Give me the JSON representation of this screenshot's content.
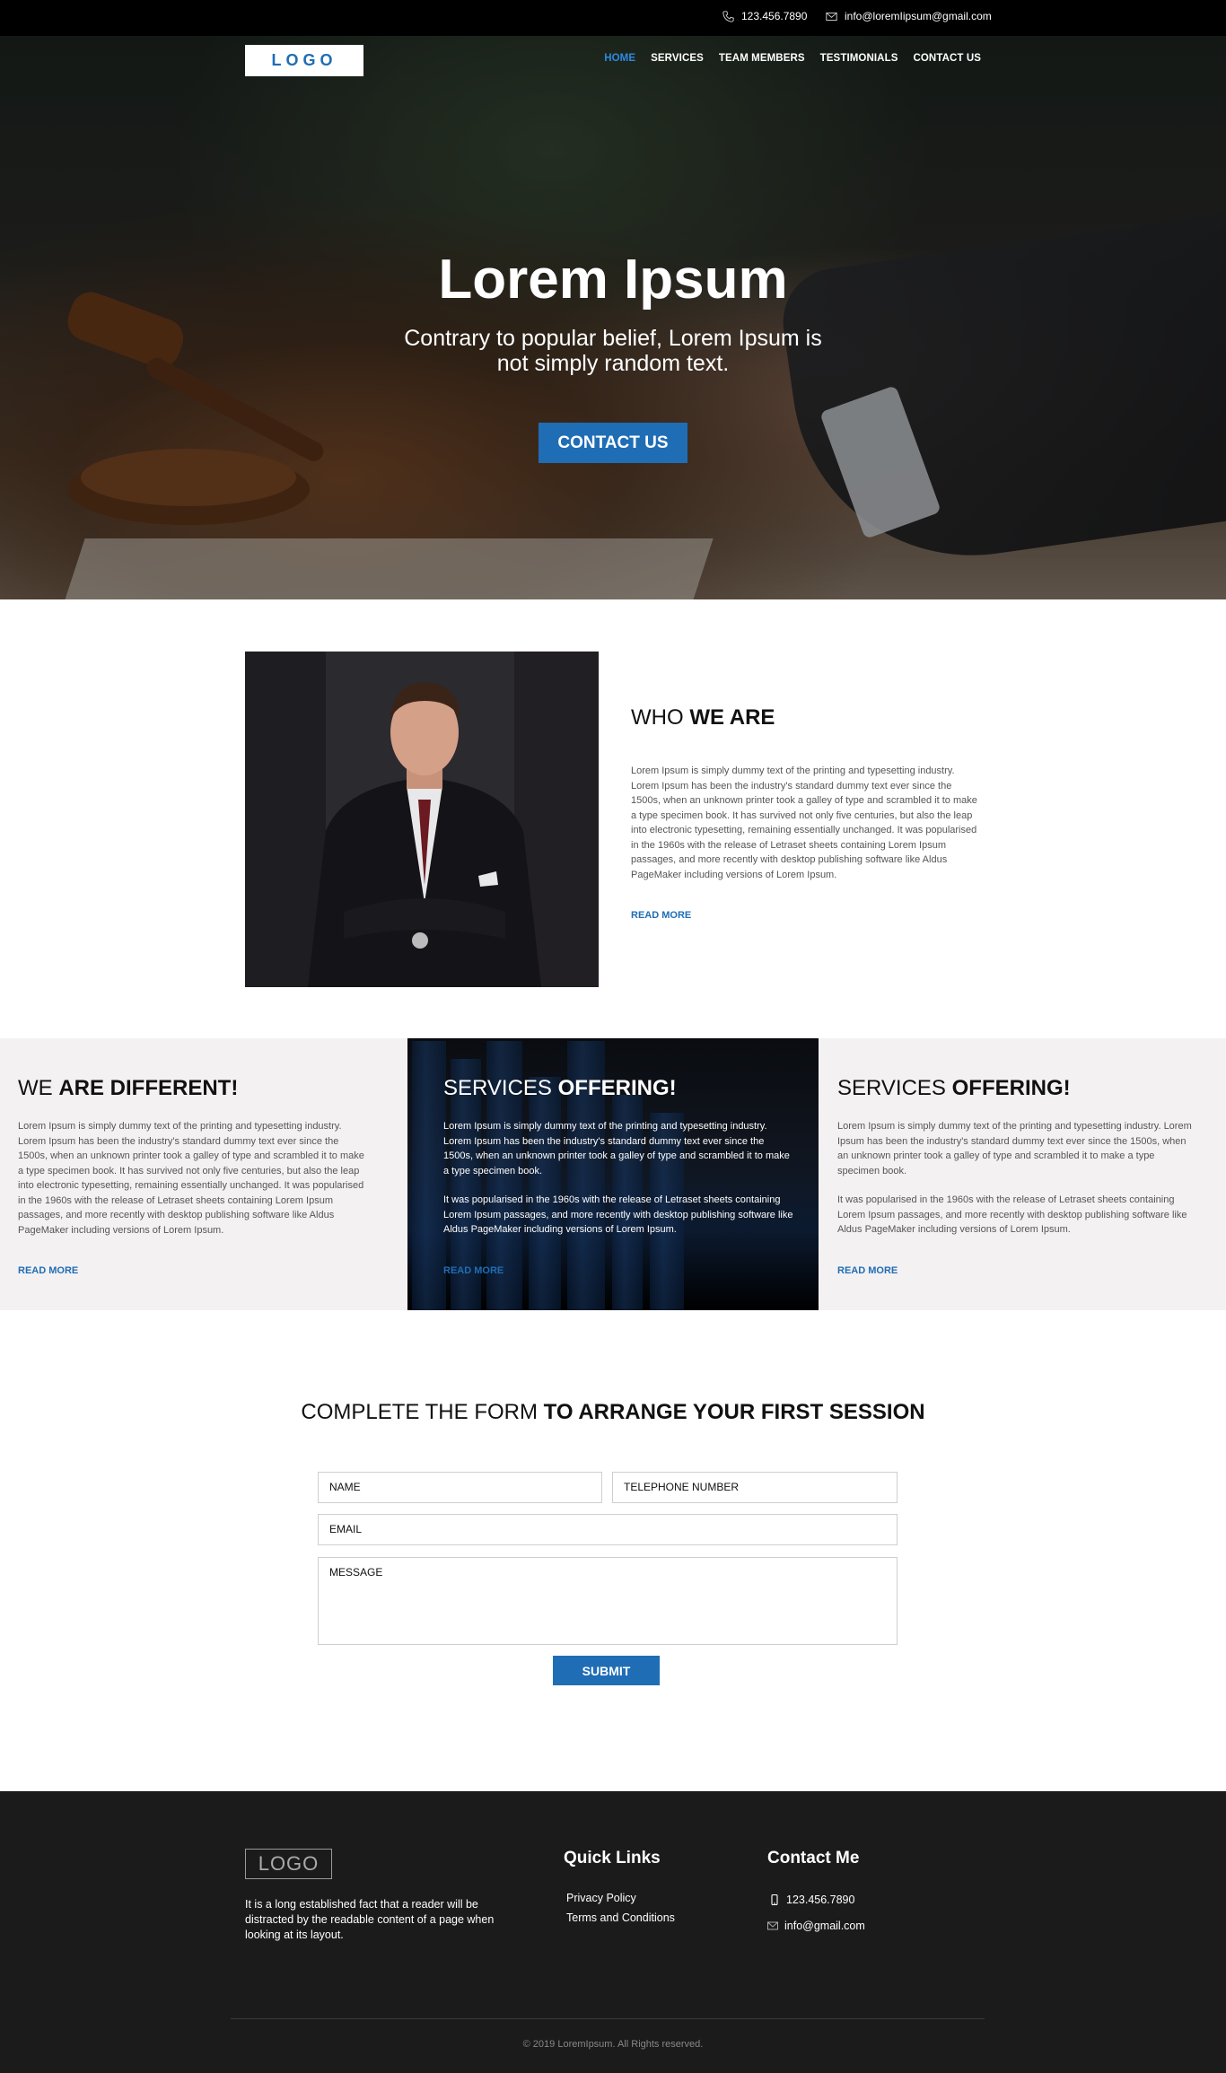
{
  "topbar": {
    "phone": "123.456.7890",
    "email": "info@loremIipsum@gmail.com",
    "phone_icon": "phone-icon",
    "email_icon": "envelope-icon"
  },
  "header": {
    "logo": "LOGO",
    "nav": [
      {
        "label": "HOME",
        "active": true
      },
      {
        "label": "SERVICES",
        "active": false
      },
      {
        "label": "TEAM MEMBERS",
        "active": false
      },
      {
        "label": "TESTIMONIALS",
        "active": false
      },
      {
        "label": "CONTACT US",
        "active": false
      }
    ],
    "active_color": "#2b8ae0"
  },
  "hero": {
    "title": "Lorem Ipsum",
    "subtitle": "Contrary to popular belief, Lorem Ipsum is not simply random text.",
    "cta": "CONTACT US"
  },
  "who": {
    "title_light": "WHO ",
    "title_bold": "WE ARE",
    "text": "Lorem Ipsum is simply dummy text of the printing and typesetting industry. Lorem Ipsum has been the industry's standard dummy text ever since the 1500s, when an unknown printer took a galley of type and scrambled it to make a type specimen book. It has survived not only five centuries, but also the leap into electronic typesetting, remaining essentially unchanged. It was popularised in the 1960s with the release of Letraset sheets containing Lorem Ipsum passages, and more recently with desktop publishing software like Aldus PageMaker including versions of Lorem Ipsum.",
    "read_more": "READ MORE"
  },
  "columns": [
    {
      "title_light": "WE ",
      "title_bold": "ARE DIFFERENT!",
      "text": "Lorem Ipsum is simply dummy text of the printing and typesetting industry. Lorem Ipsum has been the industry's standard dummy text ever since the 1500s, when an unknown printer took a galley of type and scrambled it to make a type specimen book. It has survived not only five centuries, but also the leap into electronic typesetting, remaining essentially unchanged. It was popularised in the 1960s with the release of Letraset sheets containing Lorem Ipsum passages, and more recently with desktop publishing software like Aldus PageMaker including versions of Lorem Ipsum.",
      "read_more": "READ MORE"
    },
    {
      "title_light": "SERVICES ",
      "title_bold": "OFFERING!",
      "text_p1": "Lorem Ipsum is simply dummy text of the printing and typesetting industry. Lorem Ipsum has been the industry's standard dummy text ever since the 1500s, when an unknown printer took a galley of type and scrambled it to make a type specimen book.",
      "text_p2": "It was popularised in the 1960s with the release of Letraset sheets containing Lorem Ipsum passages, and more recently with desktop publishing software like Aldus PageMaker including versions of Lorem Ipsum.",
      "read_more": "READ MORE"
    },
    {
      "title_light": "SERVICES ",
      "title_bold": "OFFERING!",
      "text_p1": "Lorem Ipsum is simply dummy text of the printing and typesetting industry. Lorem Ipsum has been the industry's standard dummy text ever since the 1500s, when an unknown printer took a galley of type and scrambled it to make a type specimen book.",
      "text_p2": "It was popularised in the 1960s with the release of Letraset sheets containing Lorem Ipsum passages, and more recently with desktop publishing software like Aldus PageMaker including versions of Lorem Ipsum.",
      "read_more": "READ MORE"
    }
  ],
  "form": {
    "title_light": "COMPLETE THE FORM ",
    "title_bold": "TO ARRANGE YOUR FIRST SESSION",
    "name_placeholder": "NAME",
    "phone_placeholder": "TELEPHONE NUMBER",
    "email_placeholder": "EMAIL",
    "message_placeholder": "MESSAGE",
    "submit": "SUBMIT"
  },
  "footer": {
    "logo": "LOGO",
    "about": "It is a long established fact that a reader will be distracted by the readable content of a page when looking at its layout.",
    "quick_links_title": "Quick Links",
    "quick_links": [
      "Privacy Policy",
      "Terms and Conditions"
    ],
    "contact_title": "Contact Me",
    "phone": "123.456.7890",
    "email": "info@gmail.com",
    "copyright": "© 2019 LoremIpsum. All Rights reserved."
  },
  "colors": {
    "brand_blue": "#1f6db5",
    "footer_bg": "#1b1b1c",
    "section_bg": "#f4f1f2"
  }
}
